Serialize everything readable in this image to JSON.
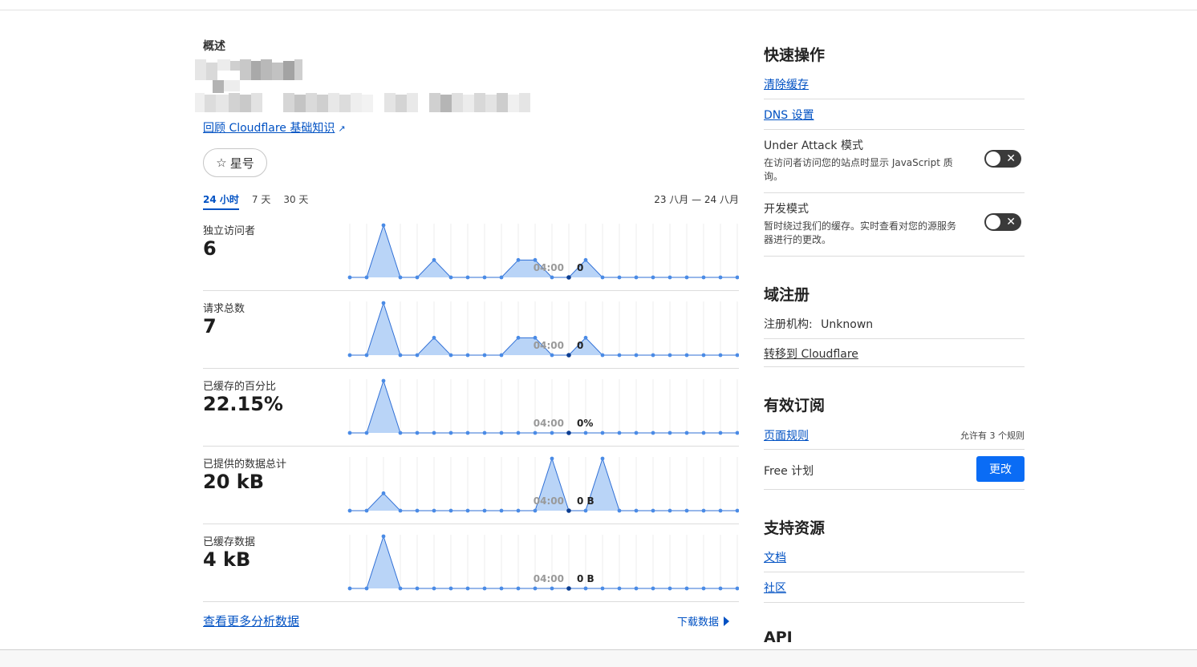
{
  "overview": {
    "title": "概述",
    "review_link": "回顾 Cloudflare 基础知识",
    "star_label": "星号",
    "tabs": [
      "24 小时",
      "7 天",
      "30 天"
    ],
    "active_tab": 0,
    "date_range": "23 八月 — 24 八月",
    "more_analytics": "查看更多分析数据",
    "download": "下载数据"
  },
  "metrics": [
    {
      "label": "独立访问者",
      "value": "6",
      "hover_time": "04:00",
      "hover_value": "0"
    },
    {
      "label": "请求总数",
      "value": "7",
      "hover_time": "04:00",
      "hover_value": "0"
    },
    {
      "label": "已缓存的百分比",
      "value": "22.15%",
      "hover_time": "04:00",
      "hover_value": "0%"
    },
    {
      "label": "已提供的数据总计",
      "value": "20 kB",
      "hover_time": "04:00",
      "hover_value": "0 B"
    },
    {
      "label": "已缓存数据",
      "value": "4 kB",
      "hover_time": "04:00",
      "hover_value": "0 B"
    }
  ],
  "chart_data": [
    {
      "type": "area",
      "title": "独立访问者",
      "values": [
        0,
        0,
        3,
        0,
        0,
        1,
        0,
        0,
        0,
        0,
        1,
        1,
        0,
        0,
        1,
        0,
        0,
        0,
        0,
        0,
        0,
        0,
        0,
        0
      ],
      "highlight_index": 13,
      "hover_label": "04:00",
      "hover_value": "0"
    },
    {
      "type": "area",
      "title": "请求总数",
      "values": [
        0,
        0,
        3,
        0,
        0,
        1,
        0,
        0,
        0,
        0,
        1,
        1,
        0,
        0,
        1,
        0,
        0,
        0,
        0,
        0,
        0,
        0,
        0,
        0
      ],
      "highlight_index": 13,
      "hover_label": "04:00",
      "hover_value": "0"
    },
    {
      "type": "area",
      "title": "已缓存的百分比",
      "values": [
        0,
        0,
        1,
        0,
        0,
        0,
        0,
        0,
        0,
        0,
        0,
        0,
        0,
        0,
        0,
        0,
        0,
        0,
        0,
        0,
        0,
        0,
        0,
        0
      ],
      "highlight_index": 13,
      "hover_label": "04:00",
      "hover_value": "0%"
    },
    {
      "type": "area",
      "title": "已提供的数据总计",
      "values": [
        0,
        0,
        1,
        0,
        0,
        0,
        0,
        0,
        0,
        0,
        0,
        0,
        3,
        0,
        0,
        3,
        0,
        0,
        0,
        0,
        0,
        0,
        0,
        0
      ],
      "highlight_index": 13,
      "hover_label": "04:00",
      "hover_value": "0 B"
    },
    {
      "type": "area",
      "title": "已缓存数据",
      "values": [
        0,
        0,
        1,
        0,
        0,
        0,
        0,
        0,
        0,
        0,
        0,
        0,
        0,
        0,
        0,
        0,
        0,
        0,
        0,
        0,
        0,
        0,
        0,
        0
      ],
      "highlight_index": 13,
      "hover_label": "04:00",
      "hover_value": "0 B"
    }
  ],
  "quick_actions": {
    "title": "快速操作",
    "purge_cache": "清除缓存",
    "dns_settings": "DNS 设置",
    "under_attack_title": "Under Attack 模式",
    "under_attack_desc": "在访问者访问您的站点时显示 JavaScript 质询。",
    "dev_mode_title": "开发模式",
    "dev_mode_desc": "暂时绕过我们的缓存。实时查看对您的源服务器进行的更改。",
    "toggle_off_symbol": "✕"
  },
  "domain_registration": {
    "title": "域注册",
    "registrar_label": "注册机构:",
    "registrar_value": "Unknown",
    "transfer_link": "转移到 Cloudflare"
  },
  "subscriptions": {
    "title": "有效订阅",
    "page_rules": "页面规则",
    "page_rules_quota": "允许有 3 个规则",
    "plan": "Free 计划",
    "change_button": "更改"
  },
  "support": {
    "title": "支持资源",
    "docs": "文档",
    "community": "社区"
  },
  "api": {
    "title": "API"
  },
  "colors": {
    "accent": "#0051c3",
    "chart_line": "#2f6fd6",
    "chart_fill": "#b9d4f7",
    "button": "#0a6cf5"
  },
  "icons": {
    "star": "☆",
    "external_link": "↗"
  }
}
